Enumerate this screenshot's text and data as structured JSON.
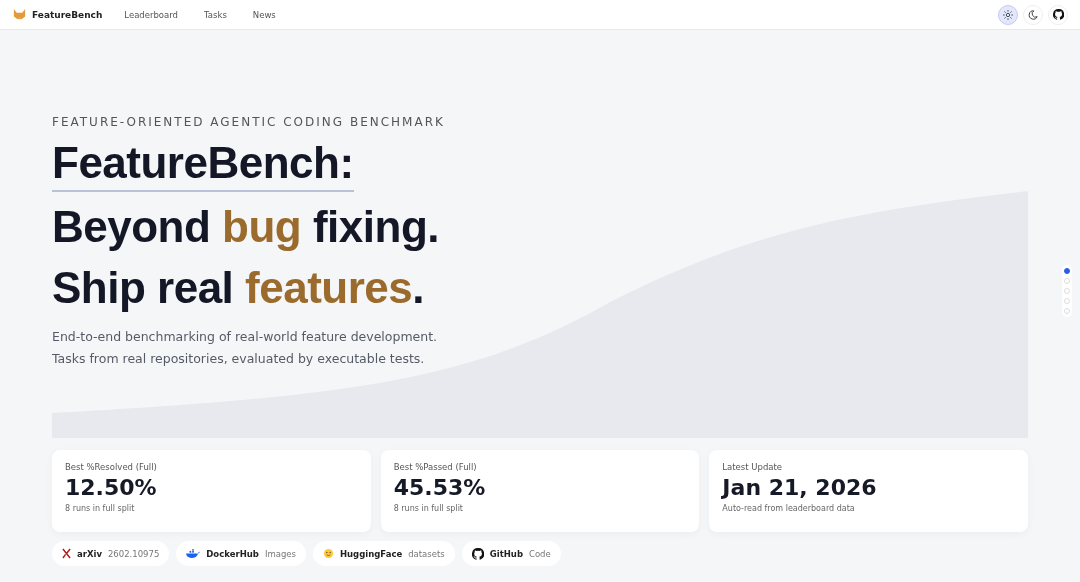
{
  "nav": {
    "brand": "FeatureBench",
    "links": [
      {
        "label": "Leaderboard"
      },
      {
        "label": "Tasks"
      },
      {
        "label": "News"
      }
    ],
    "theme": [
      {
        "kind": "light",
        "selected": true
      },
      {
        "kind": "dark",
        "selected": false
      }
    ]
  },
  "hero": {
    "eyebrow": "FEATURE-ORIENTED AGENTIC CODING BENCHMARK",
    "lines": [
      {
        "underline": true,
        "segments": [
          {
            "text": "FeatureBench:",
            "accent": false
          }
        ]
      },
      {
        "underline": false,
        "segments": [
          {
            "text": "Beyond ",
            "accent": false
          },
          {
            "text": "bug",
            "accent": true
          },
          {
            "text": " fixing.",
            "accent": false
          }
        ]
      },
      {
        "underline": false,
        "segments": [
          {
            "text": "Ship real ",
            "accent": false
          },
          {
            "text": "features",
            "accent": true
          },
          {
            "text": ".",
            "accent": false
          }
        ]
      }
    ],
    "subtitle": [
      "End-to-end benchmarking of real-world feature development.",
      "Tasks from real repositories, evaluated by executable tests."
    ]
  },
  "stats": [
    {
      "label": "Best %Resolved (Full)",
      "value": "12.50%",
      "note": "8 runs in full split"
    },
    {
      "label": "Best %Passed (Full)",
      "value": "45.53%",
      "note": "8 runs in full split"
    },
    {
      "label": "Latest Update",
      "value": "Jan 21, 2026",
      "note": "Auto-read from leaderboard data"
    }
  ],
  "links": [
    {
      "kind": "arxiv",
      "name": "arXiv",
      "detail": "2602.10975"
    },
    {
      "kind": "docker",
      "name": "DockerHub",
      "detail": "Images"
    },
    {
      "kind": "huggingface",
      "name": "HuggingFace",
      "detail": "datasets"
    },
    {
      "kind": "github",
      "name": "GitHub",
      "detail": "Code"
    }
  ],
  "section_dots": [
    {
      "selected": true
    },
    {
      "selected": false
    },
    {
      "selected": false
    },
    {
      "selected": false
    },
    {
      "selected": false
    }
  ]
}
